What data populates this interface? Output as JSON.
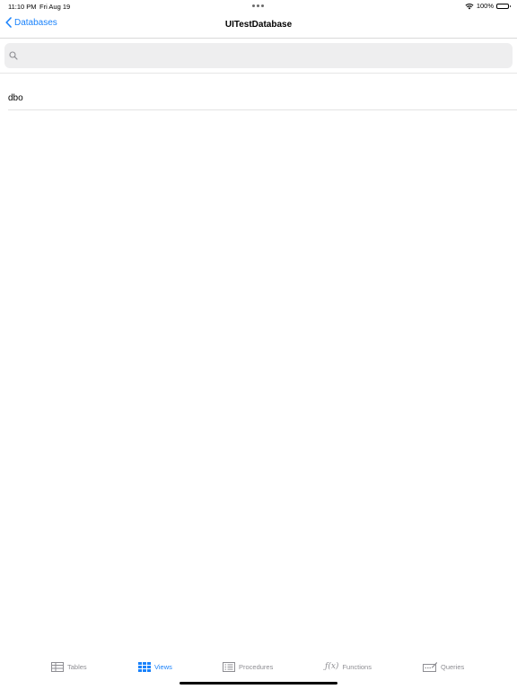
{
  "status_bar": {
    "time": "11:10 PM",
    "date": "Fri Aug 19",
    "battery": "100%"
  },
  "nav": {
    "back_label": "Databases",
    "title": "UITestDatabase"
  },
  "search": {
    "placeholder": "",
    "value": ""
  },
  "list": {
    "items": [
      {
        "label": "dbo"
      }
    ]
  },
  "tabs": [
    {
      "label": "Tables",
      "icon": "table-icon",
      "active": false
    },
    {
      "label": "Views",
      "icon": "grid-icon",
      "active": true
    },
    {
      "label": "Procedures",
      "icon": "procedure-icon",
      "active": false
    },
    {
      "label": "Functions",
      "icon": "function-icon",
      "active": false
    },
    {
      "label": "Queries",
      "icon": "query-icon",
      "active": false
    }
  ],
  "colors": {
    "accent": "#1a82fb",
    "inactive": "#8e8e93"
  }
}
